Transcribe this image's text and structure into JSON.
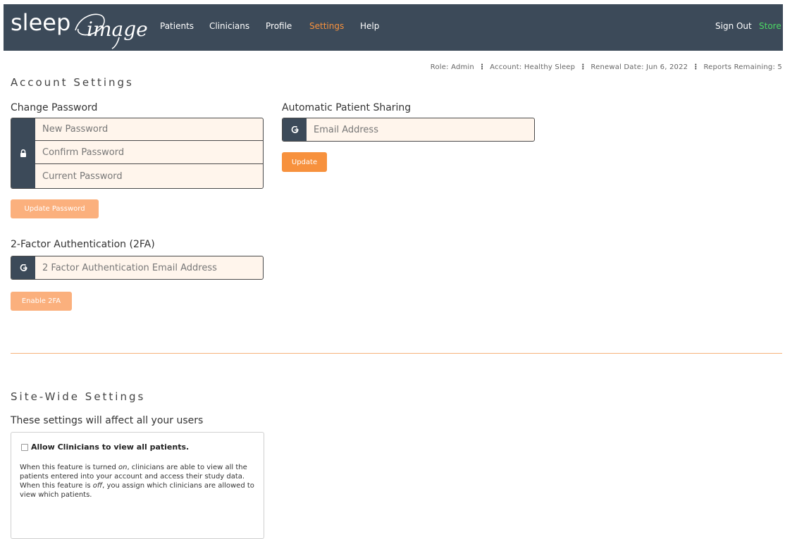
{
  "nav": {
    "logo_text": "sleep",
    "logo_script": "image",
    "items": [
      "Patients",
      "Clinicians",
      "Profile",
      "Settings",
      "Help"
    ],
    "active": "Settings",
    "sign_out": "Sign Out",
    "store": "Store"
  },
  "info": {
    "role": "Role: Admin",
    "account": "Account: Healthy Sleep",
    "renewal": "Renewal Date: Jun 6, 2022",
    "reports": "Reports Remaining: 5",
    "separator": "⋮"
  },
  "account_settings": {
    "title": "Account Settings",
    "change_password": {
      "title": "Change Password",
      "new_placeholder": "New Password",
      "confirm_placeholder": "Confirm Password",
      "current_placeholder": "Current Password",
      "button": "Update Password"
    },
    "two_factor": {
      "title": "2-Factor Authentication (2FA)",
      "placeholder": "2 Factor Authentication Email Address",
      "button": "Enable 2FA"
    },
    "sharing": {
      "title": "Automatic Patient Sharing",
      "placeholder": "Email Address",
      "button": "Update"
    }
  },
  "site_settings": {
    "title": "Site-Wide Settings",
    "subtitle": "These settings will affect all your users",
    "option": {
      "label": "Allow Clinicians to view all patients.",
      "checked": false,
      "desc1_pre": "When this feature is turned ",
      "desc1_em": "on",
      "desc1_post": ", clinicians are able to view all the patients entered into your account and access their study data.",
      "desc2_pre": "When this feature is ",
      "desc2_em": "off",
      "desc2_post": ", you assign which clinicians are allowed to view which patients."
    }
  },
  "colors": {
    "nav_bg": "#3c4a59",
    "accent": "#f7913d",
    "accent_light": "#fbb07d",
    "store": "#4cd964",
    "input_bg": "#fff5ec"
  },
  "icons": {
    "password_addon": "lock-icon",
    "email_addon": "share-icon"
  }
}
